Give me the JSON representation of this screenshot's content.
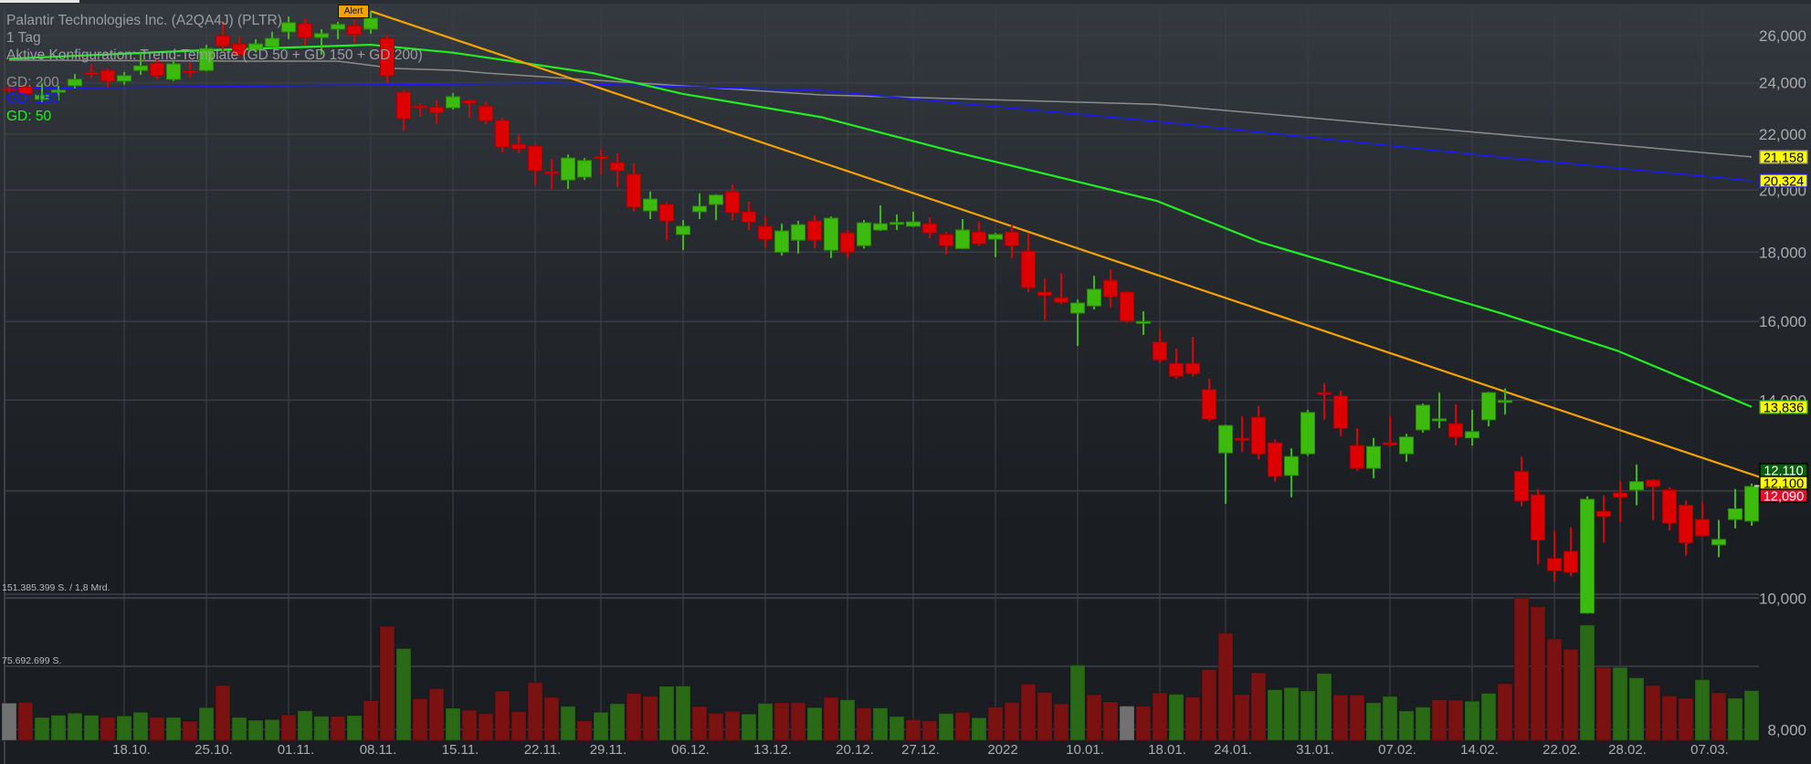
{
  "header": {
    "title": "Palantir Technologies Inc. (A2QA4J) (PLTR)",
    "interval": "1 Tag",
    "config": "Aktive Konfiguration: Trend-Template (GD 50 + GD 150 + GD 200)",
    "alert_label": "Alert"
  },
  "legend": [
    {
      "label": "GD: 200",
      "color": "#8c8c8c"
    },
    {
      "label": "GD: 150",
      "color": "#1a1aff"
    },
    {
      "label": "GD: 50",
      "color": "#22ee22"
    }
  ],
  "volume_labels": {
    "max": "151.385.399 S. / 1,8 Mrd.",
    "half": "75.692.699 S."
  },
  "colors": {
    "up": "#3cbb0e",
    "up_border": "#2c8a0a",
    "down": "#dd0000",
    "down_border": "#a80000",
    "vol_up": "#2a6a16",
    "vol_down": "#7a1212",
    "vol_neutral": "#717171",
    "grid": "#3b3f45",
    "trend": "#f5a300"
  },
  "chart_data": {
    "type": "candlestick",
    "title": "Palantir Technologies Inc. (A2QA4J) (PLTR)",
    "y_scale": "log",
    "ylim": [
      7.9,
      27.5
    ],
    "currency_note": "EUR",
    "y_ticks": [
      {
        "value": 26,
        "label": "26,000"
      },
      {
        "value": 24,
        "label": "24,000"
      },
      {
        "value": 22,
        "label": "22,000"
      },
      {
        "value": 20,
        "label": "20,000"
      },
      {
        "value": 18,
        "label": "18,000"
      },
      {
        "value": 16,
        "label": "16,000"
      },
      {
        "value": 14,
        "label": "14,000"
      },
      {
        "value": 12,
        "label": "12,000"
      },
      {
        "value": 10,
        "label": "10,000"
      },
      {
        "value": 8,
        "label": "8,000"
      }
    ],
    "x_ticks": [
      {
        "idx": 7,
        "label": "18.10."
      },
      {
        "idx": 12,
        "label": "25.10."
      },
      {
        "idx": 17,
        "label": "01.11."
      },
      {
        "idx": 22,
        "label": "08.11."
      },
      {
        "idx": 27,
        "label": "15.11."
      },
      {
        "idx": 32,
        "label": "22.11."
      },
      {
        "idx": 36,
        "label": "29.11."
      },
      {
        "idx": 41,
        "label": "06.12."
      },
      {
        "idx": 46,
        "label": "13.12."
      },
      {
        "idx": 51,
        "label": "20.12."
      },
      {
        "idx": 55,
        "label": "27.12."
      },
      {
        "idx": 60,
        "label": "2022"
      },
      {
        "idx": 65,
        "label": "10.01."
      },
      {
        "idx": 70,
        "label": "18.01."
      },
      {
        "idx": 74,
        "label": "24.01."
      },
      {
        "idx": 79,
        "label": "31.01."
      },
      {
        "idx": 84,
        "label": "07.02."
      },
      {
        "idx": 89,
        "label": "14.02."
      },
      {
        "idx": 94,
        "label": "22.02."
      },
      {
        "idx": 98,
        "label": "28.02."
      },
      {
        "idx": 103,
        "label": "07.03."
      }
    ],
    "ohlc_fields": [
      "open",
      "high",
      "low",
      "close"
    ],
    "candles": [
      [
        23.76,
        23.85,
        23.62,
        23.73
      ],
      [
        23.84,
        23.92,
        23.29,
        23.55
      ],
      [
        23.33,
        23.99,
        23.22,
        23.51
      ],
      [
        23.62,
        23.88,
        23.29,
        23.7
      ],
      [
        23.88,
        24.36,
        23.77,
        24.14
      ],
      [
        24.42,
        24.78,
        24.21,
        24.38
      ],
      [
        24.51,
        24.59,
        23.81,
        24.07
      ],
      [
        24.07,
        24.44,
        23.92,
        24.29
      ],
      [
        24.51,
        25.24,
        24.33,
        24.7
      ],
      [
        24.82,
        25.01,
        24.14,
        24.29
      ],
      [
        24.14,
        24.94,
        24.07,
        24.78
      ],
      [
        24.49,
        24.86,
        24.21,
        24.45
      ],
      [
        24.51,
        25.6,
        24.47,
        25.44
      ],
      [
        26.0,
        26.66,
        25.37,
        25.56
      ],
      [
        25.64,
        25.96,
        25.09,
        25.17
      ],
      [
        25.37,
        25.84,
        25.28,
        25.64
      ],
      [
        25.52,
        26.17,
        25.44,
        25.88
      ],
      [
        26.17,
        26.86,
        25.84,
        26.58
      ],
      [
        26.54,
        26.78,
        25.56,
        25.92
      ],
      [
        25.92,
        26.29,
        25.17,
        26.09
      ],
      [
        26.29,
        26.62,
        25.84,
        26.5
      ],
      [
        26.45,
        26.7,
        25.68,
        26.05
      ],
      [
        26.29,
        27.11,
        26.09,
        26.78
      ],
      [
        25.88,
        26.05,
        23.99,
        24.29
      ],
      [
        23.62,
        23.7,
        22.13,
        22.58
      ],
      [
        23.07,
        23.18,
        22.65,
        23.03
      ],
      [
        23.03,
        23.29,
        22.37,
        22.82
      ],
      [
        23.0,
        23.58,
        22.93,
        23.44
      ],
      [
        23.29,
        23.33,
        22.61,
        23.18
      ],
      [
        23.07,
        23.25,
        22.37,
        22.51
      ],
      [
        22.51,
        22.61,
        21.32,
        21.52
      ],
      [
        21.62,
        21.99,
        21.29,
        21.45
      ],
      [
        21.55,
        21.62,
        20.16,
        20.68
      ],
      [
        20.63,
        21.09,
        20.04,
        20.6
      ],
      [
        20.35,
        21.25,
        20.04,
        21.12
      ],
      [
        20.45,
        21.12,
        20.35,
        21.03
      ],
      [
        21.17,
        21.45,
        20.55,
        21.14
      ],
      [
        20.96,
        21.29,
        20.1,
        20.68
      ],
      [
        20.55,
        20.93,
        19.28,
        19.43
      ],
      [
        19.31,
        19.95,
        19.04,
        19.7
      ],
      [
        19.52,
        19.58,
        18.37,
        18.98
      ],
      [
        18.55,
        19.01,
        18.06,
        18.81
      ],
      [
        19.28,
        19.89,
        19.04,
        19.46
      ],
      [
        19.52,
        19.86,
        19.01,
        19.83
      ],
      [
        19.95,
        20.2,
        19.01,
        19.25
      ],
      [
        19.28,
        19.61,
        18.69,
        18.95
      ],
      [
        18.81,
        19.13,
        18.14,
        18.4
      ],
      [
        18.0,
        18.89,
        17.9,
        18.66
      ],
      [
        18.37,
        18.98,
        17.96,
        18.86
      ],
      [
        18.98,
        19.16,
        18.11,
        18.37
      ],
      [
        18.06,
        19.13,
        17.82,
        19.07
      ],
      [
        18.6,
        18.69,
        17.82,
        18.0
      ],
      [
        18.2,
        19.01,
        18.11,
        18.92
      ],
      [
        18.69,
        19.49,
        18.66,
        18.89
      ],
      [
        18.9,
        19.19,
        18.69,
        18.93
      ],
      [
        18.81,
        19.28,
        18.78,
        18.95
      ],
      [
        18.89,
        19.1,
        18.43,
        18.6
      ],
      [
        18.55,
        18.63,
        17.93,
        18.2
      ],
      [
        18.11,
        19.04,
        18.09,
        18.69
      ],
      [
        18.63,
        18.95,
        18.2,
        18.26
      ],
      [
        18.4,
        18.6,
        17.85,
        18.55
      ],
      [
        18.63,
        18.84,
        17.82,
        18.2
      ],
      [
        18.03,
        18.6,
        16.82,
        16.95
      ],
      [
        16.82,
        17.21,
        16.04,
        16.72
      ],
      [
        16.66,
        17.37,
        16.48,
        16.53
      ],
      [
        16.23,
        16.61,
        15.35,
        16.51
      ],
      [
        16.43,
        17.29,
        16.33,
        16.9
      ],
      [
        17.16,
        17.48,
        16.38,
        16.69
      ],
      [
        16.82,
        16.85,
        15.96,
        16.01
      ],
      [
        15.97,
        16.28,
        15.64,
        16.0
      ],
      [
        15.45,
        15.79,
        14.92,
        14.99
      ],
      [
        14.9,
        15.28,
        14.52,
        14.58
      ],
      [
        14.9,
        15.59,
        14.58,
        14.65
      ],
      [
        14.25,
        14.52,
        13.5,
        13.56
      ],
      [
        12.8,
        13.43,
        11.74,
        13.41
      ],
      [
        13.12,
        13.62,
        12.82,
        13.09
      ],
      [
        13.6,
        13.86,
        12.66,
        12.78
      ],
      [
        13.02,
        13.09,
        12.19,
        12.3
      ],
      [
        12.32,
        12.9,
        11.87,
        12.72
      ],
      [
        12.78,
        13.77,
        12.74,
        13.71
      ],
      [
        14.18,
        14.41,
        13.54,
        14.14
      ],
      [
        14.1,
        14.22,
        13.17,
        13.35
      ],
      [
        12.96,
        13.35,
        12.42,
        12.47
      ],
      [
        12.47,
        13.13,
        12.26,
        12.94
      ],
      [
        13.02,
        13.62,
        12.94,
        12.99
      ],
      [
        12.78,
        13.22,
        12.61,
        13.15
      ],
      [
        13.31,
        13.92,
        13.25,
        13.88
      ],
      [
        13.52,
        14.18,
        13.35,
        13.56
      ],
      [
        13.45,
        13.9,
        12.96,
        13.15
      ],
      [
        13.13,
        13.77,
        12.96,
        13.27
      ],
      [
        13.54,
        14.2,
        13.39,
        14.18
      ],
      [
        13.95,
        14.28,
        13.66,
        13.99
      ],
      [
        12.4,
        12.72,
        11.69,
        11.8
      ],
      [
        11.92,
        12.04,
        10.59,
        11.04
      ],
      [
        10.7,
        11.21,
        10.29,
        10.48
      ],
      [
        10.83,
        11.28,
        10.38,
        10.45
      ],
      [
        9.75,
        11.89,
        9.74,
        11.83
      ],
      [
        11.59,
        11.91,
        10.99,
        11.49
      ],
      [
        11.96,
        12.21,
        11.38,
        11.87
      ],
      [
        12.02,
        12.55,
        11.71,
        12.19
      ],
      [
        12.22,
        12.24,
        11.42,
        12.09
      ],
      [
        12.02,
        12.07,
        11.22,
        11.36
      ],
      [
        11.71,
        11.8,
        10.75,
        10.99
      ],
      [
        11.43,
        11.78,
        11.1,
        11.12
      ],
      [
        10.95,
        11.42,
        10.72,
        11.05
      ],
      [
        11.43,
        12.04,
        11.26,
        11.64
      ],
      [
        11.4,
        12.15,
        11.31,
        12.09
      ]
    ],
    "volume_max_millions": 151.385399,
    "volumes_millions": [
      39.5,
      40.5,
      24.3,
      26.6,
      28.8,
      26.6,
      24.6,
      25.9,
      29.8,
      24.6,
      24.3,
      20.4,
      34.7,
      58.3,
      24.3,
      21.4,
      22.0,
      27.2,
      31.4,
      25.6,
      25.6,
      26.2,
      42.1,
      121.2,
      97.5,
      44.4,
      54.8,
      34.0,
      32.1,
      28.5,
      52.5,
      30.5,
      61.6,
      45.7,
      36.0,
      20.7,
      29.8,
      38.9,
      49.9,
      47.0,
      57.3,
      57.7,
      36.0,
      28.8,
      30.8,
      27.9,
      39.2,
      39.9,
      40.2,
      34.7,
      45.7,
      43.1,
      34.3,
      34.3,
      25.3,
      22.0,
      20.7,
      28.5,
      29.8,
      24.0,
      35.3,
      40.5,
      59.9,
      50.9,
      38.9,
      80.0,
      48.6,
      40.8,
      36.3,
      36.3,
      50.5,
      48.9,
      46.0,
      75.2,
      114.0,
      48.6,
      71.9,
      53.8,
      56.1,
      52.5,
      71.0,
      48.3,
      48.3,
      39.9,
      46.7,
      31.1,
      35.3,
      43.1,
      42.8,
      41.5,
      49.9,
      60.3,
      151.4,
      142.2,
      107.6,
      96.9,
      122.5,
      77.4,
      77.4,
      66.4,
      58.3,
      47.3,
      44.7,
      64.5,
      50.5,
      44.7,
      52.8
    ],
    "volume_direction": "nduuuuduudududuuuduudud duddudddddduduudduuddduuddududuuddudud dddduddndduddddduuuudduuuudduuddddduduuddduduu",
    "moving_averages": [
      {
        "name": "GD 50",
        "color": "#22ee22",
        "points": [
          [
            0,
            25.0
          ],
          [
            11,
            25.34
          ],
          [
            22,
            25.6
          ],
          [
            27,
            25.26
          ],
          [
            35.5,
            24.4
          ],
          [
            41,
            23.55
          ],
          [
            49.4,
            22.64
          ],
          [
            57.8,
            21.3
          ],
          [
            69.8,
            19.64
          ],
          [
            76.1,
            18.31
          ],
          [
            90.8,
            16.22
          ],
          [
            97.8,
            15.23
          ],
          [
            106,
            13.84
          ]
        ]
      },
      {
        "name": "GD 150",
        "color": "#1a1aff",
        "points": [
          [
            0,
            23.77
          ],
          [
            27,
            23.95
          ],
          [
            33,
            23.99
          ],
          [
            49.4,
            23.69
          ],
          [
            69.7,
            22.48
          ],
          [
            90.8,
            21.15
          ],
          [
            106,
            20.32
          ]
        ]
      },
      {
        "name": "GD 200",
        "color": "#8c8c8c",
        "points": [
          [
            0,
            24.94
          ],
          [
            14.3,
            24.9
          ],
          [
            20,
            24.9
          ],
          [
            23.5,
            24.59
          ],
          [
            27.2,
            24.51
          ],
          [
            29,
            24.4
          ],
          [
            49.4,
            23.51
          ],
          [
            69.7,
            23.14
          ],
          [
            90.8,
            21.98
          ],
          [
            106,
            21.16
          ]
        ]
      }
    ],
    "trendline": {
      "color": "#f5a300",
      "from": [
        22.0,
        27.1
      ],
      "to": [
        106.8,
        12.25
      ]
    },
    "current_price": 12.1,
    "price_badges": [
      {
        "value": 21.158,
        "label": "21,158",
        "bg": "#ffff00",
        "border": "#8c8c8c",
        "fg": "#000000"
      },
      {
        "value": 20.324,
        "label": "20,324",
        "bg": "#ffff00",
        "border": "#1a1aff",
        "fg": "#000000"
      },
      {
        "value": 13.836,
        "label": "13,836",
        "bg": "#ffff00",
        "border": "#22aa22",
        "fg": "#000000"
      },
      {
        "value": 12.11,
        "label": "12,110",
        "bg": "#0b5e0b",
        "border": "#000000",
        "fg": "#ffffff"
      },
      {
        "value": 12.1,
        "label": "12,100",
        "bg": "#ffff00",
        "border": "#000000",
        "fg": "#000000"
      },
      {
        "value": 12.09,
        "label": "12,090",
        "bg": "#e0102a",
        "border": "#000000",
        "fg": "#ffffff"
      }
    ]
  }
}
